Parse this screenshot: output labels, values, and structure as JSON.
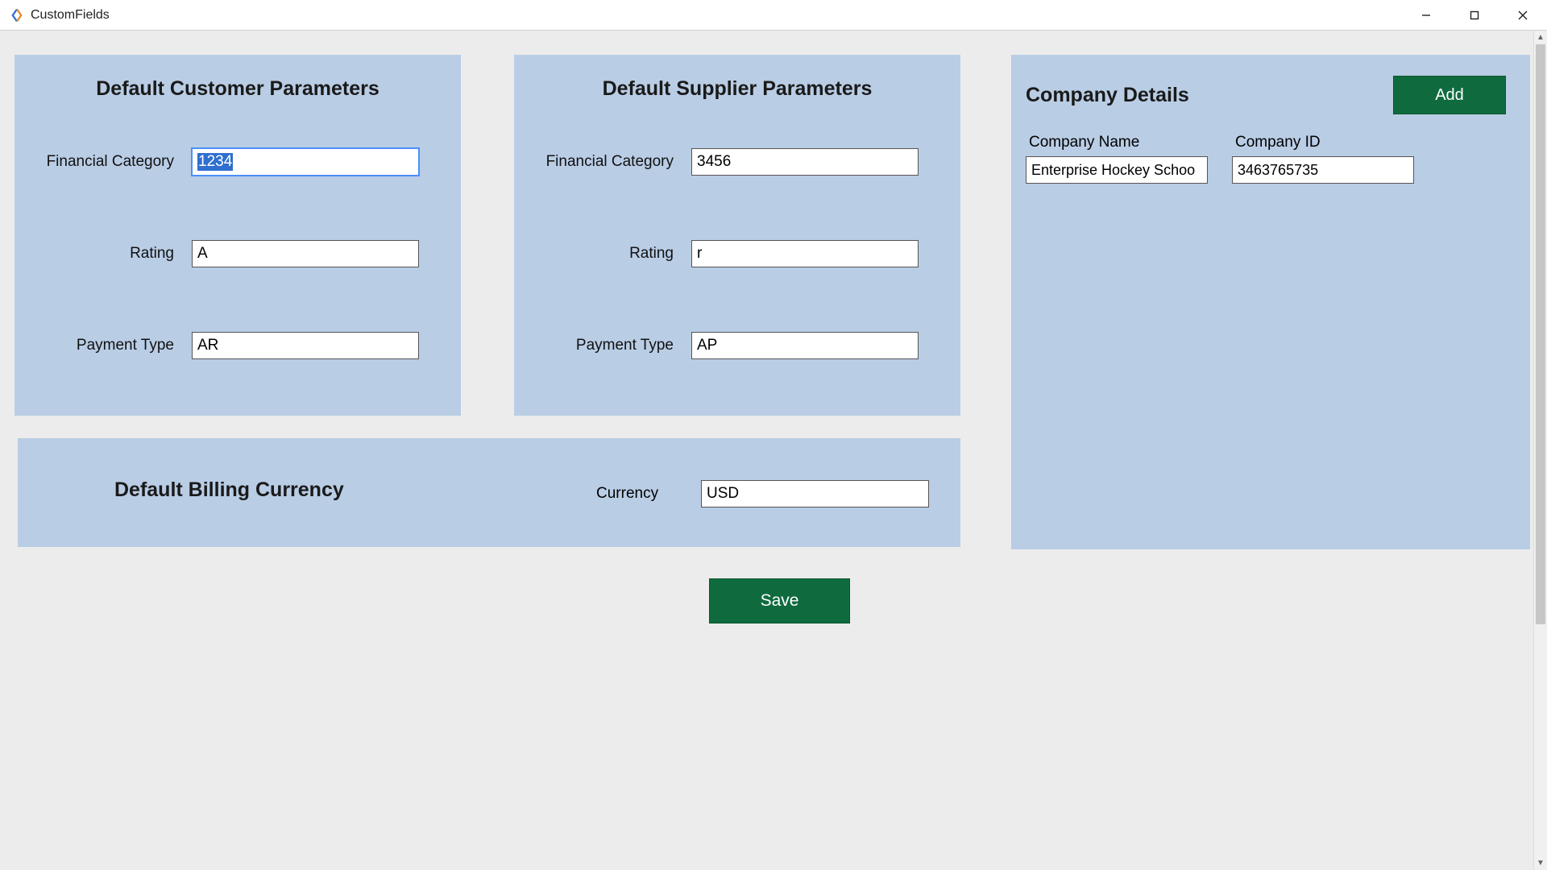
{
  "window": {
    "title": "CustomFields"
  },
  "customer": {
    "title": "Default Customer Parameters",
    "fields": {
      "financial_category": {
        "label": "Financial Category",
        "value": "1234"
      },
      "rating": {
        "label": "Rating",
        "value": "A"
      },
      "payment_type": {
        "label": "Payment Type",
        "value": "AR"
      }
    }
  },
  "supplier": {
    "title": "Default Supplier Parameters",
    "fields": {
      "financial_category": {
        "label": "Financial Category",
        "value": "3456"
      },
      "rating": {
        "label": "Rating",
        "value": "r"
      },
      "payment_type": {
        "label": "Payment Type",
        "value": "AP"
      }
    }
  },
  "billing": {
    "title": "Default Billing Currency",
    "currency_label": "Currency",
    "currency_value": "USD"
  },
  "company": {
    "title": "Company  Details",
    "add_label": "Add",
    "name_label": "Company Name",
    "id_label": "Company ID",
    "name_value": "Enterprise Hockey Schoo",
    "id_value": "3463765735"
  },
  "actions": {
    "save_label": "Save"
  },
  "colors": {
    "panel_bg": "#B9CDE5",
    "button_green": "#0F6B3E",
    "page_bg": "#ECECEC"
  }
}
